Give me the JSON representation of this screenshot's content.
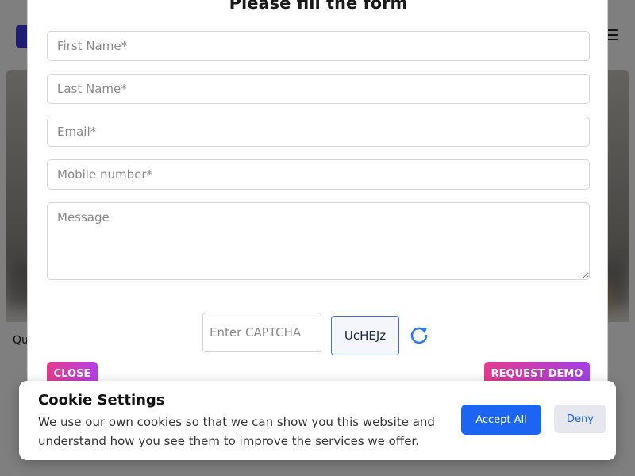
{
  "background": {
    "hero_caption": "Qu",
    "colors": {
      "logo": "#3d3ae0",
      "cta": "#7a3ff2"
    }
  },
  "modal": {
    "title": "Please fill the form",
    "fields": {
      "first_name": {
        "placeholder": "First Name*",
        "value": ""
      },
      "last_name": {
        "placeholder": "Last Name*",
        "value": ""
      },
      "email": {
        "placeholder": "Email*",
        "value": ""
      },
      "mobile": {
        "placeholder": "Mobile number*",
        "value": ""
      },
      "message": {
        "placeholder": "Message",
        "value": ""
      }
    },
    "captcha": {
      "placeholder": "Enter CAPTCHA",
      "code": "UcHEJz",
      "refresh_icon": "refresh-icon"
    },
    "close_label": "CLOSE",
    "submit_label": "REQUEST DEMO",
    "colors": {
      "button_gradient_start": "#e63b8f",
      "button_gradient_end": "#a23fe6",
      "captcha_border": "#3b73d8"
    }
  },
  "cookie_banner": {
    "title": "Cookie Settings",
    "text": "We use our own cookies so that we can show you this website and understand how you see them to improve the services we offer.",
    "accept_label": "Accept All",
    "deny_label": "Deny",
    "colors": {
      "accept": "#1c64f2",
      "deny_bg": "#e6e8ee"
    }
  }
}
